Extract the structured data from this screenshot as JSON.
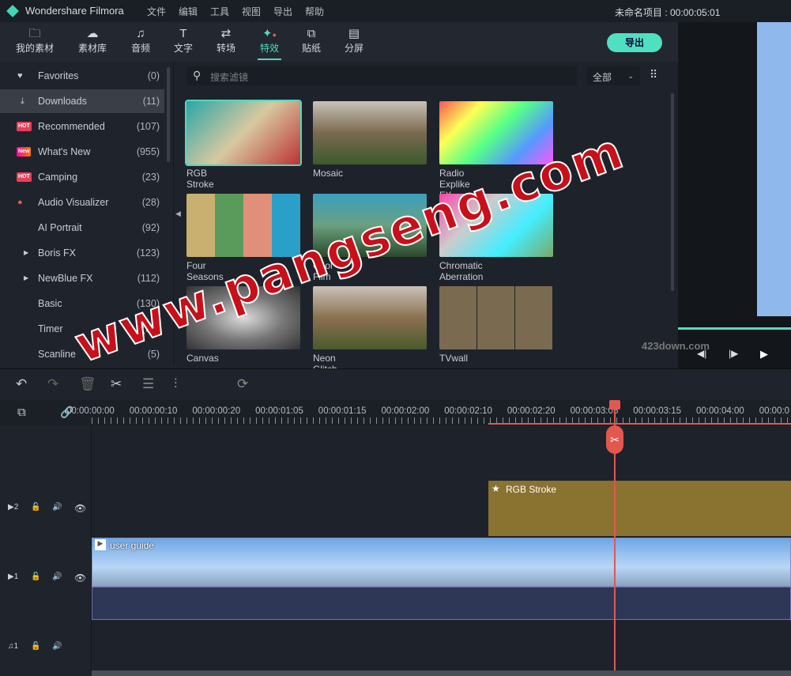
{
  "titlebar": {
    "app_name": "Wondershare Filmora",
    "menus": [
      "文件",
      "编辑",
      "工具",
      "视图",
      "导出",
      "帮助"
    ],
    "project": "未命名项目 : 00:00:05:01"
  },
  "toolbar": {
    "tabs": [
      {
        "label": "我的素材",
        "icon": "folder-icon"
      },
      {
        "label": "素材库",
        "icon": "cloud-folder-icon"
      },
      {
        "label": "音频",
        "icon": "music-icon"
      },
      {
        "label": "文字",
        "icon": "text-icon"
      },
      {
        "label": "转场",
        "icon": "transition-icon"
      },
      {
        "label": "特效",
        "icon": "effects-icon",
        "active": true
      },
      {
        "label": "贴纸",
        "icon": "sticker-icon"
      },
      {
        "label": "分屏",
        "icon": "split-screen-icon"
      }
    ],
    "export": "导出"
  },
  "sidebar": {
    "items": [
      {
        "label": "Favorites",
        "count": "(0)",
        "icon": "heart-icon"
      },
      {
        "label": "Downloads",
        "count": "(11)",
        "icon": "download-icon",
        "selected": true
      },
      {
        "label": "Recommended",
        "count": "(107)",
        "badge": "HOT"
      },
      {
        "label": "What's New",
        "count": "(955)",
        "badge": "New"
      },
      {
        "label": "Camping",
        "count": "(23)",
        "badge": "HOT"
      },
      {
        "label": "Audio Visualizer",
        "count": "(28)",
        "dot": true
      },
      {
        "label": "AI Portrait",
        "count": "(92)"
      },
      {
        "label": "Boris FX",
        "count": "(123)",
        "expand": true
      },
      {
        "label": "NewBlue FX",
        "count": "(112)",
        "expand": true
      },
      {
        "label": "Basic",
        "count": "(130)"
      },
      {
        "label": "Timer",
        "count": "(50)"
      },
      {
        "label": "Scanline",
        "count": "(5)"
      }
    ]
  },
  "search": {
    "placeholder": "搜索滤镜",
    "filter": "全部"
  },
  "effects": [
    {
      "label": "RGB Stroke",
      "selected": true
    },
    {
      "label": "Mosaic"
    },
    {
      "label": "Radio Explike FX"
    },
    {
      "label": "Four Seasons"
    },
    {
      "label": "Cool Film"
    },
    {
      "label": "Chromatic Aberration"
    },
    {
      "label": "Canvas"
    },
    {
      "label": "Neon Glitch"
    },
    {
      "label": "TVwall"
    }
  ],
  "timeline": {
    "ruler": [
      "00:00:00:00",
      "00:00:00:10",
      "00:00:00:20",
      "00:00:01:05",
      "00:00:01:15",
      "00:00:02:00",
      "00:00:02:10",
      "00:00:02:20",
      "00:00:03:05",
      "00:00:03:15",
      "00:00:04:00",
      "00:00:0"
    ],
    "tracks": [
      {
        "label": "2",
        "type": "video"
      },
      {
        "label": "1",
        "type": "video"
      },
      {
        "label": "1",
        "type": "audio"
      }
    ],
    "fx_clip": "RGB Stroke",
    "video_clip": "user guide"
  },
  "watermark": {
    "text": "www.pangseng.com",
    "logo": "423down.com"
  },
  "colors": {
    "accent": "#4fe0c1",
    "playhead": "#e2584f",
    "fx_clip": "#8a7230"
  }
}
